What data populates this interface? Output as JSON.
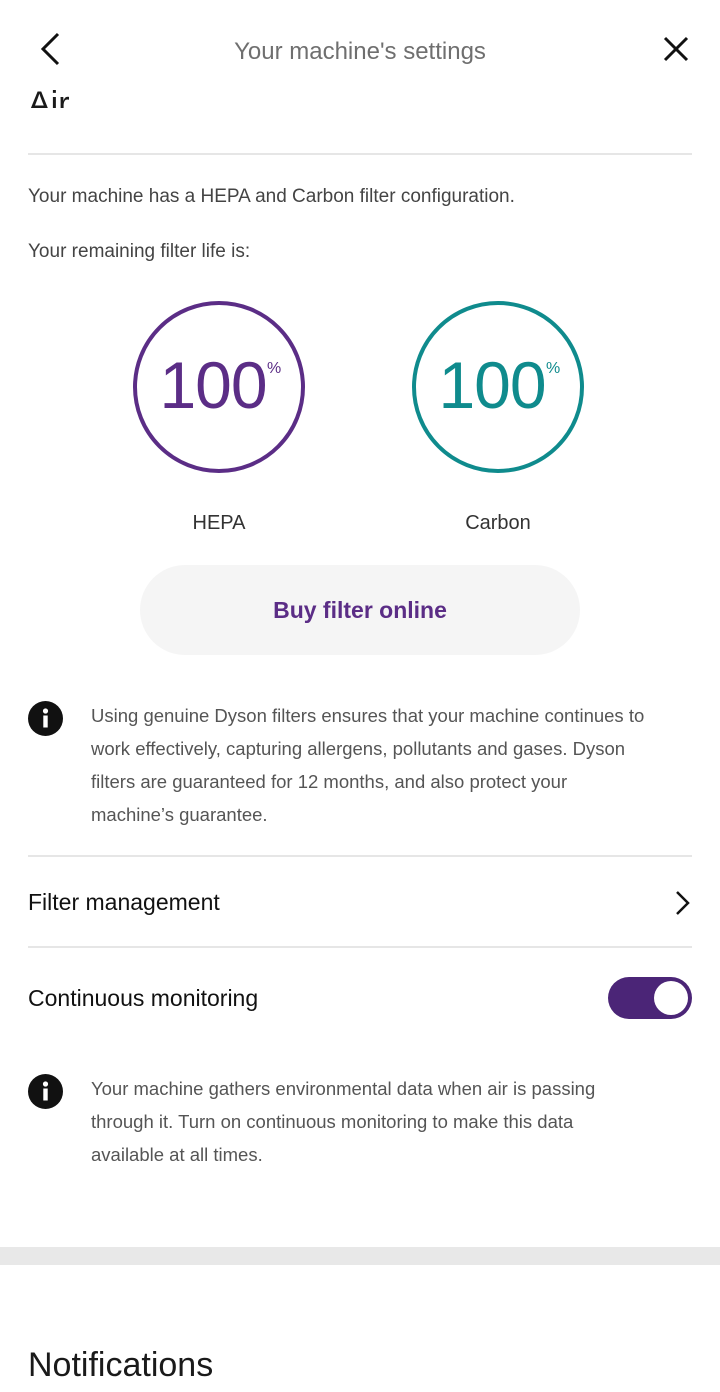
{
  "header": {
    "title": "Your machine's settings"
  },
  "air_section": {
    "title": "Air",
    "config_text": "Your machine has a HEPA and Carbon filter configuration.",
    "remaining_text": "Your remaining filter life is:",
    "filters": [
      {
        "name": "HEPA",
        "value": "100",
        "unit": "%",
        "color": "#5b2d86"
      },
      {
        "name": "Carbon",
        "value": "100",
        "unit": "%",
        "color": "#0f8b8d"
      }
    ],
    "buy_label": "Buy filter online",
    "genuine_info": "Using genuine Dyson filters ensures that your machine continues to work effectively, capturing allergens, pollutants and gases. Dyson filters are guaranteed for 12 months, and also protect your machine’s guarantee.",
    "filter_management_label": "Filter management",
    "continuous_monitoring_label": "Continuous monitoring",
    "continuous_monitoring_on": true,
    "monitoring_info": "Your machine gathers environmental data when air is passing through it. Turn on continuous monitoring to make this data available at all times."
  },
  "notifications_section": {
    "title": "Notifications"
  },
  "colors": {
    "accent": "#5b2d86",
    "toggle_on": "#4b2577",
    "carbon": "#0f8b8d"
  }
}
